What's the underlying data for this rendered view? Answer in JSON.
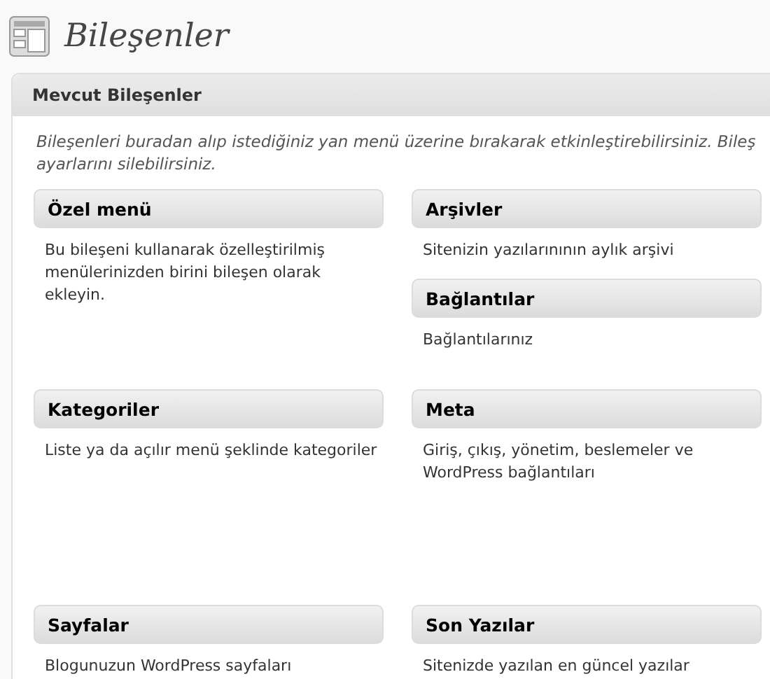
{
  "page_title": "Bileşenler",
  "panel": {
    "title": "Mevcut Bileşenler",
    "description": "Bileşenleri buradan alıp istediğiniz yan menü üzerine bırakarak etkinleştirebilirsiniz. Bileş ayarlarını silebilirsiniz.",
    "rows": [
      {
        "columns": [
          [
            {
              "title": "Özel menü",
              "description": "Bu bileşeni kullanarak özelleştirilmiş menülerinizden birini bileşen olarak ekleyin."
            }
          ],
          [
            {
              "title": "Arşivler",
              "description": "Sitenizin yazılarınının aylık arşivi"
            },
            {
              "title": "Bağlantılar",
              "description": "Bağlantılarınız"
            }
          ]
        ]
      },
      {
        "columns": [
          [
            {
              "title": "Kategoriler",
              "description": "Liste ya da açılır menü şeklinde kategoriler"
            }
          ],
          [
            {
              "title": "Meta",
              "description": "Giriş, çıkış, yönetim, beslemeler ve WordPress bağlantıları"
            }
          ]
        ]
      },
      {
        "columns": [
          [
            {
              "title": "Sayfalar",
              "description": "Blogunuzun WordPress sayfaları"
            }
          ],
          [
            {
              "title": "Son Yazılar",
              "description": "Sitenizde yazılan en güncel yazılar"
            }
          ]
        ]
      }
    ]
  }
}
